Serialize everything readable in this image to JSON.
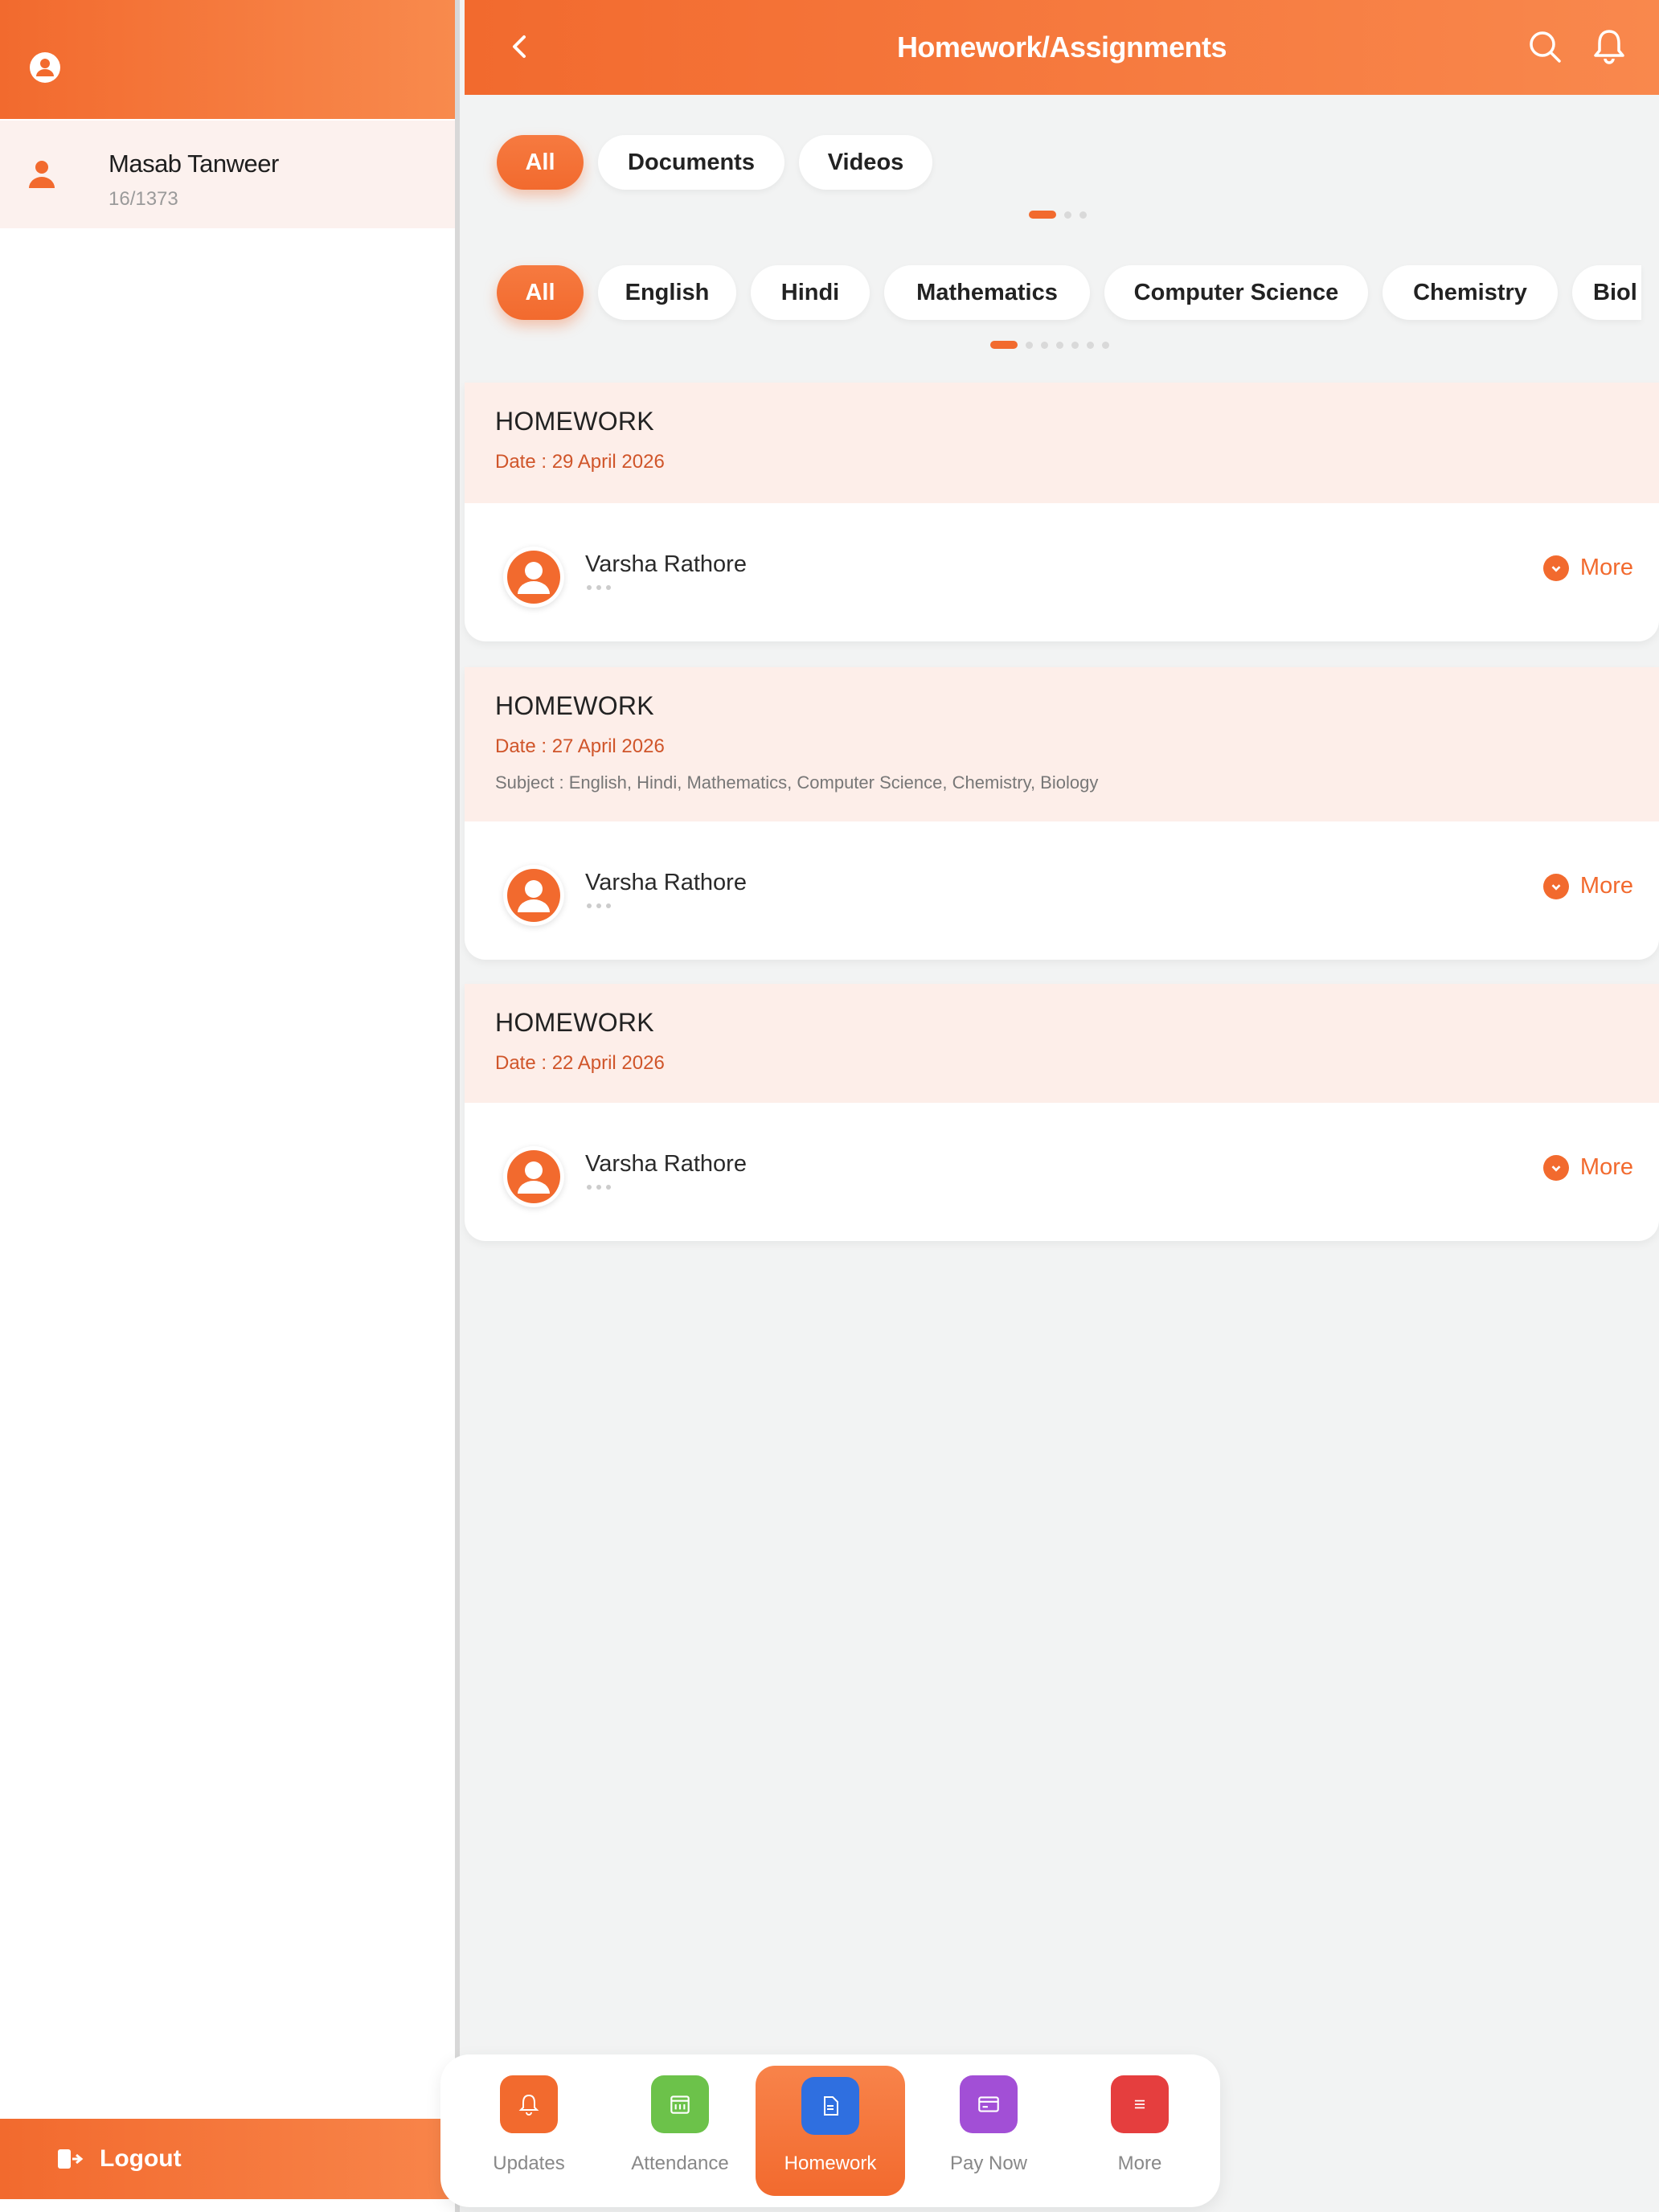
{
  "sidebar": {
    "user": {
      "name": "Masab Tanweer",
      "id": "16/1373"
    },
    "logout_label": "Logout"
  },
  "header": {
    "title": "Homework/Assignments"
  },
  "type_filters": [
    "All",
    "Documents",
    "Videos"
  ],
  "subject_filters": [
    "All",
    "English",
    "Hindi",
    "Mathematics",
    "Computer Science",
    "Chemistry",
    "Biol"
  ],
  "cards": [
    {
      "type": "HOMEWORK",
      "date": "Date : 29 April 2026",
      "subject": "",
      "teacher": "Varsha Rathore",
      "more": "More"
    },
    {
      "type": "HOMEWORK",
      "date": "Date : 27 April 2026",
      "subject": "Subject : English, Hindi, Mathematics, Computer Science, Chemistry, Biology",
      "teacher": "Varsha Rathore",
      "more": "More"
    },
    {
      "type": "HOMEWORK",
      "date": "Date : 22 April 2026",
      "subject": "",
      "teacher": "Varsha Rathore",
      "more": "More"
    }
  ],
  "bottom_nav": [
    {
      "label": "Updates",
      "icon": "bell-icon",
      "color": "#f26a2e"
    },
    {
      "label": "Attendance",
      "icon": "calendar-icon",
      "color": "#6cc24a"
    },
    {
      "label": "Homework",
      "icon": "document-icon",
      "color": "#2f6fe0",
      "active": true
    },
    {
      "label": "Pay Now",
      "icon": "card-icon",
      "color": "#a24fd6"
    },
    {
      "label": "More",
      "icon": "menu-icon",
      "color": "#e53e3e"
    }
  ],
  "colors": {
    "accent": "#f26a2e",
    "card_header": "#fdeee9",
    "background": "#f2f3f3"
  }
}
